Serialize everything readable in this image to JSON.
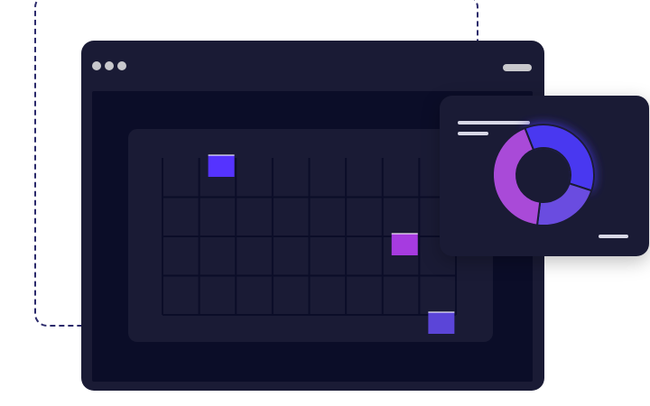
{
  "colors": {
    "dashed_frame": "#2b2a6b",
    "window_bg": "#1a1b35",
    "workspace_bg": "#0b0d28",
    "event_blue": "#5533ff",
    "event_purple": "#a63be0",
    "event_indigo": "#5b45d8",
    "donut_blue": "#4a39f0",
    "donut_purple": "#a94ad8",
    "donut_indigo": "#6a4ce0",
    "placeholder_line": "#d8d8e6"
  },
  "icons": {
    "window_controls": "three-dots-icon",
    "window_menu": "pill-icon"
  },
  "calendar": {
    "columns": 8,
    "rows": 4,
    "events": [
      {
        "col": 1,
        "row": 0,
        "color_key": "event_blue"
      },
      {
        "col": 6,
        "row": 2,
        "color_key": "event_purple"
      },
      {
        "col": 7,
        "row": 4,
        "color_key": "event_indigo"
      }
    ]
  },
  "donut": {
    "segments": [
      {
        "value": 0.36,
        "color_key": "donut_blue"
      },
      {
        "value": 0.22,
        "color_key": "donut_indigo"
      },
      {
        "value": 0.42,
        "color_key": "donut_purple"
      }
    ]
  }
}
